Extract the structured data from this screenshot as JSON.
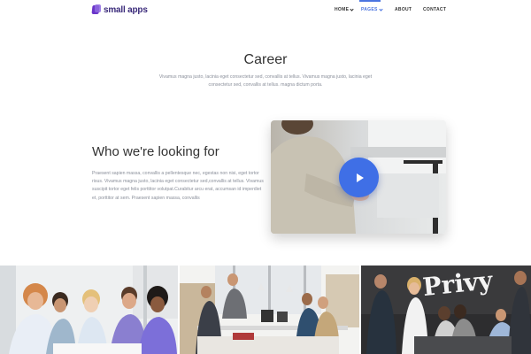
{
  "brand": {
    "name": "small apps"
  },
  "nav": {
    "home": "HOME",
    "pages": "PAGES",
    "about": "ABOUT",
    "contact": "CONTACT"
  },
  "hero": {
    "title": "Career",
    "subtitle": "Vivamus magna justo, lacinia eget consectetur sed, convallis at tellus. Vivamus magna justo, lacinia eget consectetur sed, convallis at tellus. magna dictum porta."
  },
  "section": {
    "title": "Who we're looking for",
    "body": "Praesent sapien massa, convallis a pellentesque nec, egestas non nisi, eget tortor risus. Vivamus magna justo, lacinia eget consectetur sed,convallis at tellus. Vivamus suscipit tortor eget felis porttitor volutpat.Curabitur arcu erat, accumsan id imperdiet et, porttitor at sem. Praesent sapien massa, convallis"
  },
  "photos": {
    "office_wall_text": "Privy"
  },
  "colors": {
    "accent": "#4a74e0",
    "play_button": "#3f6fe6",
    "brand": "#6a35c9"
  }
}
